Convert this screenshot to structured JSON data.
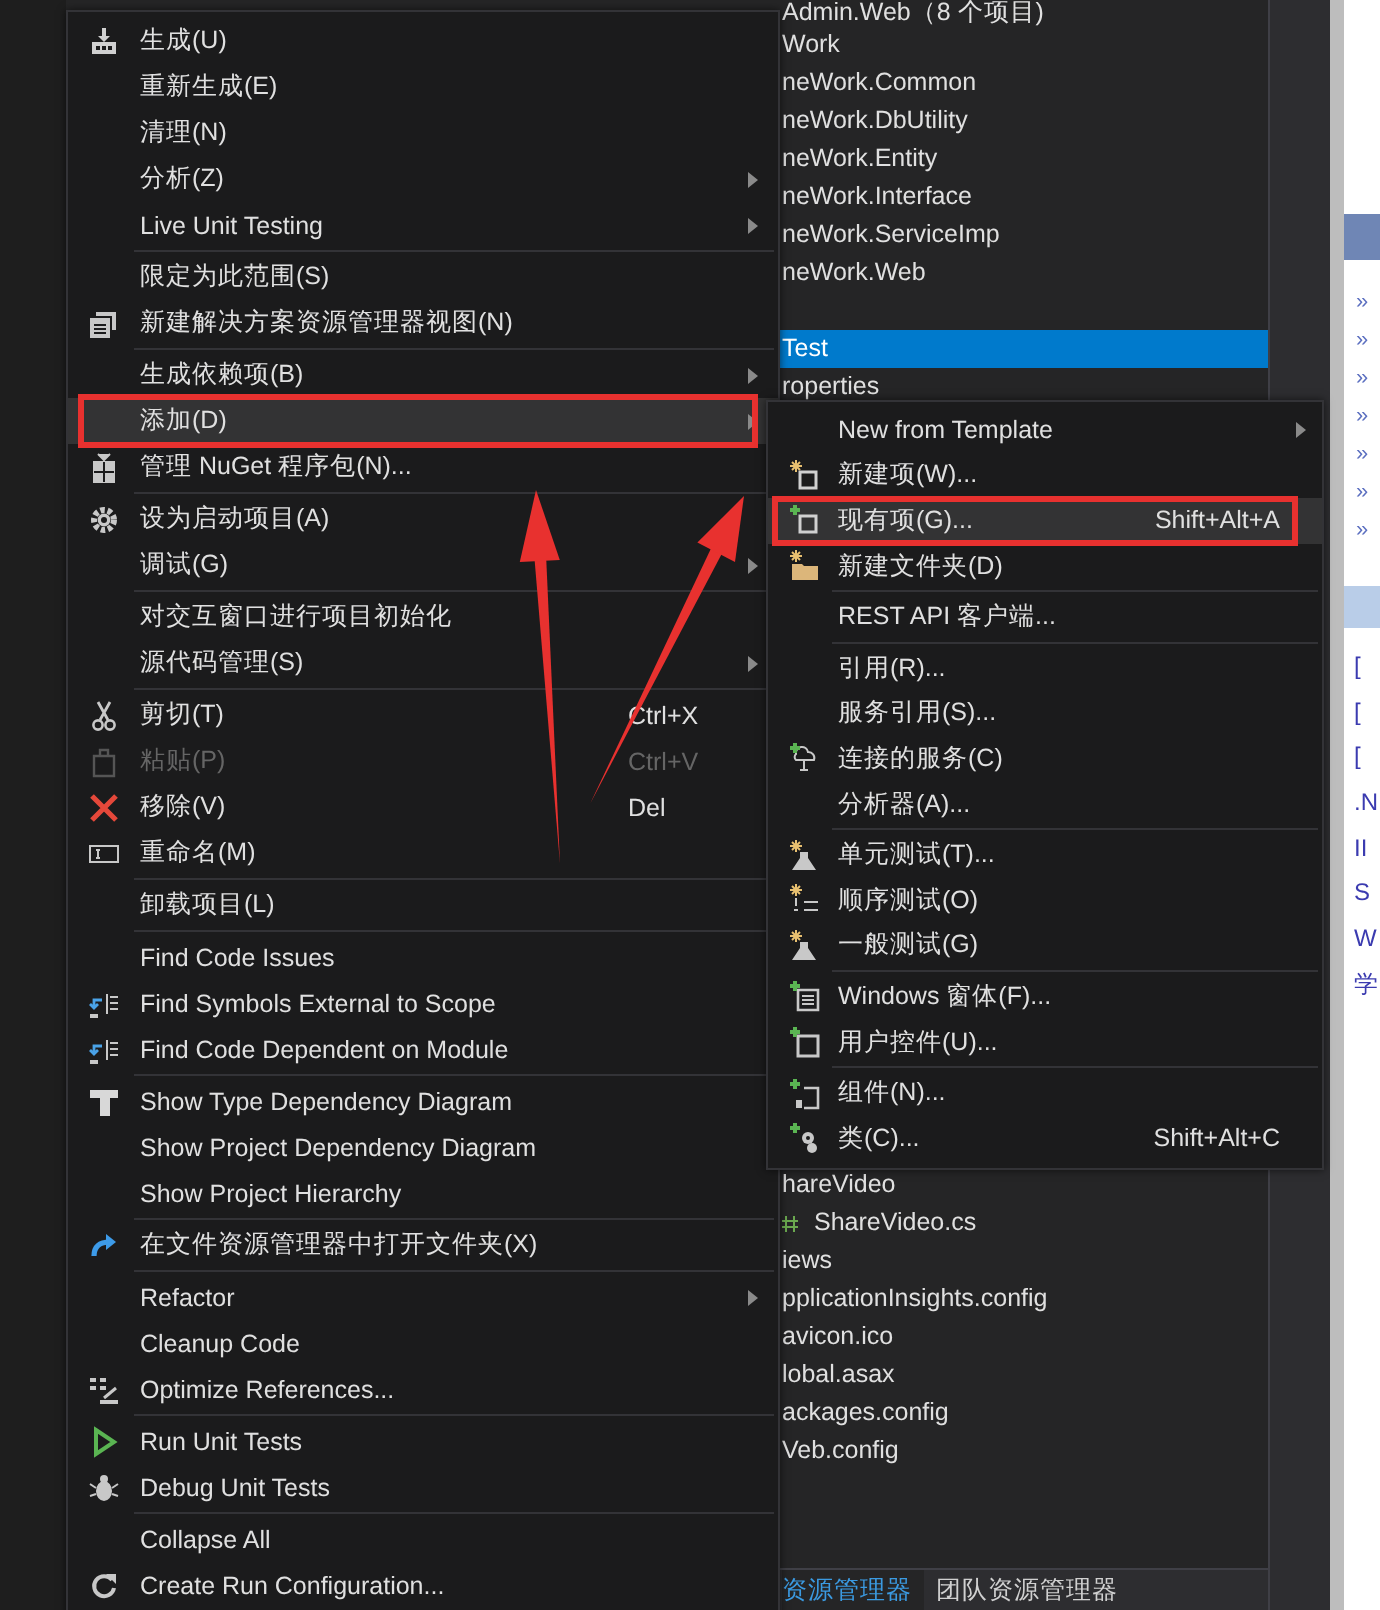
{
  "solution_explorer": {
    "solution_title": "Admin.Web（8 个项目)",
    "projects": [
      {
        "text": "Work",
        "selected": false
      },
      {
        "text": "neWork.Common",
        "selected": false
      },
      {
        "text": "neWork.DbUtility",
        "selected": false
      },
      {
        "text": "neWork.Entity",
        "selected": false
      },
      {
        "text": "neWork.Interface",
        "selected": false
      },
      {
        "text": "neWork.ServiceImp",
        "selected": false
      },
      {
        "text": "neWork.Web",
        "selected": false
      }
    ],
    "test_items": [
      {
        "text": "Test",
        "selected": true
      },
      {
        "text": "roperties",
        "selected": false
      }
    ],
    "lower_items": [
      {
        "text": "hareVideo",
        "kind": "plain",
        "selected": false
      },
      {
        "text": "ShareVideo.cs",
        "kind": "code-file",
        "selected": false
      },
      {
        "text": "iews",
        "kind": "plain",
        "selected": false
      },
      {
        "text": "pplicationInsights.config",
        "kind": "plain",
        "selected": false
      },
      {
        "text": "avicon.ico",
        "kind": "plain",
        "selected": false
      },
      {
        "text": "lobal.asax",
        "kind": "plain",
        "selected": false
      },
      {
        "text": "ackages.config",
        "kind": "plain",
        "selected": false
      },
      {
        "text": "Veb.config",
        "kind": "plain",
        "selected": false
      }
    ],
    "tabs": [
      {
        "label": "资源管理器",
        "selected": true
      },
      {
        "label": "团队资源管理器",
        "selected": false
      }
    ]
  },
  "side_panel": {
    "links": [
      "»",
      "»",
      "»",
      "»",
      "»",
      "»",
      "»"
    ],
    "lines": [
      "[",
      "[",
      "[",
      ".N",
      "II",
      "S",
      "W",
      "学"
    ]
  },
  "context_menu": {
    "groups": [
      {
        "items": [
          {
            "label": "生成(U)",
            "submenu": false,
            "disabled": false,
            "selected": false,
            "outlined": false
          },
          {
            "label": "重新生成(E)",
            "submenu": false,
            "disabled": false,
            "selected": false,
            "outlined": false
          },
          {
            "label": "清理(N)",
            "submenu": false,
            "disabled": false,
            "selected": false,
            "outlined": false
          },
          {
            "label": "分析(Z)",
            "submenu": true,
            "disabled": false,
            "selected": false,
            "outlined": false
          },
          {
            "label": "Live Unit Testing",
            "submenu": true,
            "disabled": false,
            "selected": false,
            "outlined": false
          }
        ]
      },
      {
        "items": [
          {
            "label": "限定为此范围(S)",
            "submenu": false,
            "disabled": false,
            "selected": false,
            "outlined": false
          },
          {
            "label": "新建解决方案资源管理器视图(N)",
            "submenu": false,
            "disabled": false,
            "selected": false,
            "outlined": false
          }
        ]
      },
      {
        "items": [
          {
            "label": "生成依赖项(B)",
            "submenu": true,
            "disabled": false,
            "selected": false,
            "outlined": false
          },
          {
            "label": "添加(D)",
            "submenu": true,
            "disabled": false,
            "selected": true,
            "outlined": true
          },
          {
            "label": "管理 NuGet 程序包(N)...",
            "submenu": false,
            "disabled": false,
            "selected": false,
            "outlined": false
          }
        ]
      },
      {
        "items": [
          {
            "label": "设为启动项目(A)",
            "submenu": false,
            "disabled": false,
            "selected": false,
            "outlined": false
          },
          {
            "label": "调试(G)",
            "submenu": true,
            "disabled": false,
            "selected": false,
            "outlined": false
          }
        ]
      },
      {
        "items": [
          {
            "label": "对交互窗口进行项目初始化",
            "submenu": false,
            "disabled": false,
            "selected": false,
            "outlined": false
          },
          {
            "label": "源代码管理(S)",
            "submenu": true,
            "disabled": false,
            "selected": false,
            "outlined": false
          }
        ]
      },
      {
        "items": [
          {
            "label": "剪切(T)",
            "shortcut": "Ctrl+X",
            "submenu": false,
            "disabled": false,
            "selected": false,
            "outlined": false
          },
          {
            "label": "粘贴(P)",
            "shortcut": "Ctrl+V",
            "submenu": false,
            "disabled": true,
            "selected": false,
            "outlined": false
          },
          {
            "label": "移除(V)",
            "shortcut": "Del",
            "submenu": false,
            "disabled": false,
            "selected": false,
            "outlined": false
          },
          {
            "label": "重命名(M)",
            "submenu": false,
            "disabled": false,
            "selected": false,
            "outlined": false
          }
        ]
      },
      {
        "items": [
          {
            "label": "卸载项目(L)",
            "submenu": false,
            "disabled": false,
            "selected": false,
            "outlined": false
          }
        ]
      },
      {
        "items": [
          {
            "label": "Find Code Issues",
            "submenu": false,
            "disabled": false,
            "selected": false,
            "outlined": false
          },
          {
            "label": "Find Symbols External to Scope",
            "submenu": false,
            "disabled": false,
            "selected": false,
            "outlined": false
          },
          {
            "label": "Find Code Dependent on Module",
            "submenu": false,
            "disabled": false,
            "selected": false,
            "outlined": false
          }
        ]
      },
      {
        "items": [
          {
            "label": "Show Type Dependency Diagram",
            "submenu": false,
            "disabled": false,
            "selected": false,
            "outlined": false
          },
          {
            "label": "Show Project Dependency Diagram",
            "submenu": false,
            "disabled": false,
            "selected": false,
            "outlined": false
          },
          {
            "label": "Show Project Hierarchy",
            "submenu": false,
            "disabled": false,
            "selected": false,
            "outlined": false
          }
        ]
      },
      {
        "items": [
          {
            "label": "在文件资源管理器中打开文件夹(X)",
            "submenu": false,
            "disabled": false,
            "selected": false,
            "outlined": false
          }
        ]
      },
      {
        "items": [
          {
            "label": "Refactor",
            "submenu": true,
            "disabled": false,
            "selected": false,
            "outlined": false
          },
          {
            "label": "Cleanup Code",
            "submenu": false,
            "disabled": false,
            "selected": false,
            "outlined": false
          },
          {
            "label": "Optimize References...",
            "submenu": false,
            "disabled": false,
            "selected": false,
            "outlined": false
          }
        ]
      },
      {
        "items": [
          {
            "label": "Run Unit Tests",
            "submenu": false,
            "disabled": false,
            "selected": false,
            "outlined": false
          },
          {
            "label": "Debug Unit Tests",
            "submenu": false,
            "disabled": false,
            "selected": false,
            "outlined": false
          }
        ]
      },
      {
        "items": [
          {
            "label": "Collapse All",
            "submenu": false,
            "disabled": false,
            "selected": false,
            "outlined": false
          },
          {
            "label": "Create Run Configuration...",
            "submenu": false,
            "disabled": false,
            "selected": false,
            "outlined": false
          }
        ]
      }
    ]
  },
  "submenu": {
    "groups": [
      {
        "items": [
          {
            "label": "New from Template",
            "submenu": true,
            "disabled": false,
            "selected": false,
            "outlined": false
          },
          {
            "label": "新建项(W)...",
            "submenu": false,
            "disabled": false,
            "selected": false,
            "outlined": false
          },
          {
            "label": "现有项(G)...",
            "shortcut": "Shift+Alt+A",
            "submenu": false,
            "disabled": false,
            "selected": true,
            "outlined": true
          },
          {
            "label": "新建文件夹(D)",
            "submenu": false,
            "disabled": false,
            "selected": false,
            "outlined": false
          }
        ]
      },
      {
        "items": [
          {
            "label": "REST API 客户端...",
            "submenu": false,
            "disabled": false,
            "selected": false,
            "outlined": false
          }
        ]
      },
      {
        "items": [
          {
            "label": "引用(R)...",
            "submenu": false,
            "disabled": false,
            "selected": false,
            "outlined": false
          },
          {
            "label": "服务引用(S)...",
            "submenu": false,
            "disabled": false,
            "selected": false,
            "outlined": false
          },
          {
            "label": "连接的服务(C)",
            "submenu": false,
            "disabled": false,
            "selected": false,
            "outlined": false
          },
          {
            "label": "分析器(A)...",
            "submenu": false,
            "disabled": false,
            "selected": false,
            "outlined": false
          }
        ]
      },
      {
        "items": [
          {
            "label": "单元测试(T)...",
            "submenu": false,
            "disabled": false,
            "selected": false,
            "outlined": false
          },
          {
            "label": "顺序测试(O)",
            "submenu": false,
            "disabled": false,
            "selected": false,
            "outlined": false
          },
          {
            "label": "一般测试(G)",
            "submenu": false,
            "disabled": false,
            "selected": false,
            "outlined": false
          }
        ]
      },
      {
        "items": [
          {
            "label": "Windows 窗体(F)...",
            "submenu": false,
            "disabled": false,
            "selected": false,
            "outlined": false
          },
          {
            "label": "用户控件(U)...",
            "submenu": false,
            "disabled": false,
            "selected": false,
            "outlined": false
          }
        ]
      },
      {
        "items": [
          {
            "label": "组件(N)...",
            "submenu": false,
            "disabled": false,
            "selected": false,
            "outlined": false
          },
          {
            "label": "类(C)...",
            "shortcut": "Shift+Alt+C",
            "submenu": false,
            "disabled": false,
            "selected": false,
            "outlined": false
          }
        ]
      }
    ]
  }
}
